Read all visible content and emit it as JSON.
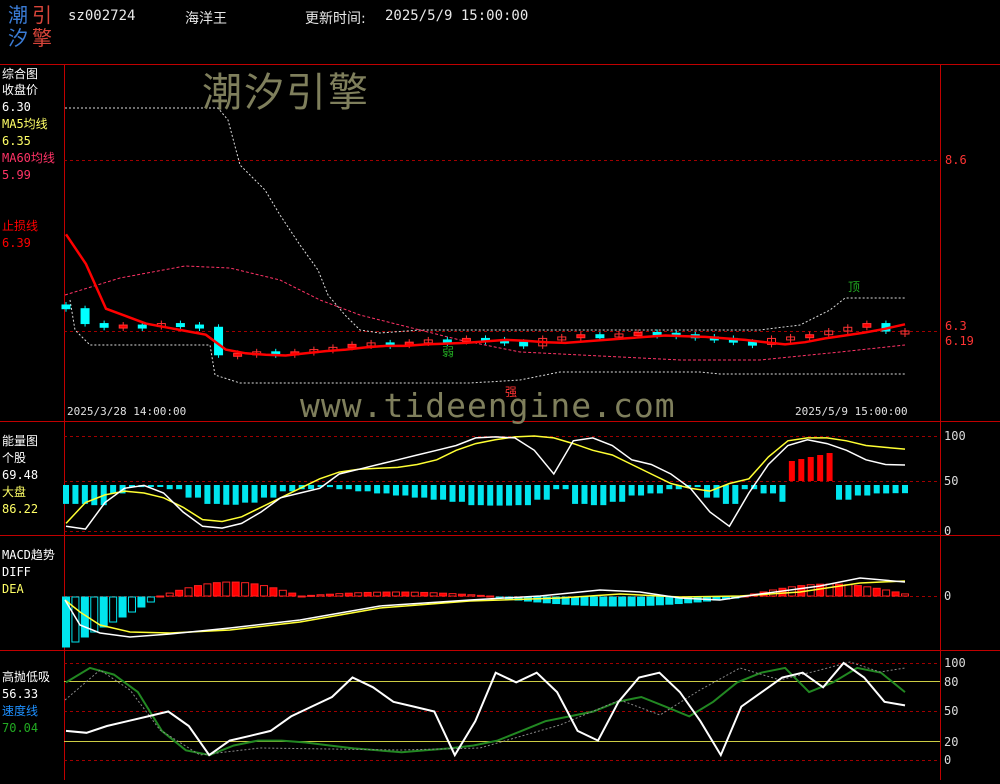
{
  "header": {
    "logo": [
      "潮",
      "引",
      "汐",
      "擎"
    ],
    "code": "sz002724",
    "name": "海洋王",
    "update_label": "更新时间:",
    "update_time": "2025/5/9 15:00:00"
  },
  "watermarks": {
    "brand": "潮汐引擎",
    "url": "www.tideengine.com"
  },
  "colors": {
    "up": "#ff0000",
    "down": "#00ffff",
    "ma5": "#ffff66",
    "ma60": "#ff3366",
    "stop": "#ff0000",
    "grid": "#c00000",
    "fast": "#ffffff",
    "speed": "#228822"
  },
  "panel_main": {
    "title": "综合图",
    "fields": [
      {
        "label": "收盘价",
        "value": "6.30",
        "color": "#ffffff"
      },
      {
        "label": "MA5均线",
        "value": "6.35",
        "color": "#ffff66"
      },
      {
        "label": "MA60均线",
        "value": "5.99",
        "color": "#ff3366"
      },
      {
        "label": "止损线",
        "value": "6.39",
        "color": "#ff0000"
      }
    ],
    "yticks": [
      {
        "text": "8.6",
        "color": "#ff3333"
      },
      {
        "text": "6.3",
        "color": "#ff3333"
      },
      {
        "text": "6.19",
        "color": "#ff3333"
      }
    ],
    "dates": [
      "2025/3/28 14:00:00",
      "2025/5/9 15:00:00"
    ],
    "markers": [
      {
        "text": "弱",
        "color": "#22aa22"
      },
      {
        "text": "强",
        "color": "#ff3333"
      },
      {
        "text": "顶",
        "color": "#22aa22"
      }
    ]
  },
  "panel_energy": {
    "title": "能量图",
    "fields": [
      {
        "label": "个股",
        "value": "69.48",
        "color": "#ffffff"
      },
      {
        "label": "大盘",
        "value": "86.22",
        "color": "#ffff66"
      }
    ],
    "yticks": [
      "100",
      "50",
      "0"
    ]
  },
  "panel_macd": {
    "title": "MACD趋势",
    "fields": [
      {
        "label": "DIFF",
        "color": "#ffffff"
      },
      {
        "label": "DEA",
        "color": "#ffff66"
      }
    ],
    "yticks": [
      "0"
    ]
  },
  "panel_osc": {
    "title": "高抛低吸",
    "fields": [
      {
        "label": "56.33",
        "color": "#ffffff"
      },
      {
        "label": "速度线",
        "color": "#1e90ff"
      },
      {
        "label": "70.04",
        "color": "#22aa22"
      }
    ],
    "yticks": [
      "100",
      "80",
      "50",
      "20",
      "0"
    ]
  },
  "chart_data": {
    "type": "line",
    "candles_close": [
      6.6,
      6.4,
      6.35,
      6.38,
      6.36,
      6.4,
      6.38,
      6.35,
      5.98,
      6.0,
      6.02,
      5.99,
      6.02,
      6.05,
      6.08,
      6.12,
      6.14,
      6.12,
      6.15,
      6.18,
      6.17,
      6.2,
      6.18,
      6.15,
      6.1,
      6.2,
      6.22,
      6.25,
      6.24,
      6.26,
      6.28,
      6.27,
      6.25,
      6.22,
      6.2,
      6.15,
      6.12,
      6.2,
      6.22,
      6.25,
      6.3,
      6.35,
      6.4,
      6.3,
      6.3
    ],
    "stop_line": [
      7.6,
      7.2,
      6.6,
      6.5,
      6.4,
      6.35,
      6.3,
      6.25,
      6.05,
      6.0,
      5.98,
      5.97,
      6.0,
      6.03,
      6.05,
      6.08,
      6.1,
      6.1,
      6.12,
      6.13,
      6.14,
      6.16,
      6.18,
      6.17,
      6.15,
      6.14,
      6.16,
      6.18,
      6.2,
      6.22,
      6.24,
      6.23,
      6.22,
      6.2,
      6.18,
      6.15,
      6.12,
      6.15,
      6.2,
      6.24,
      6.28,
      6.33,
      6.39
    ],
    "energy_stock": [
      5,
      2,
      30,
      45,
      48,
      40,
      20,
      5,
      3,
      8,
      20,
      35,
      40,
      45,
      60,
      65,
      70,
      75,
      80,
      85,
      90,
      98,
      99,
      98,
      85,
      60,
      95,
      98,
      90,
      75,
      70,
      60,
      45,
      20,
      5,
      40,
      70,
      90,
      96,
      92,
      85,
      75,
      70,
      69.48
    ],
    "energy_market": [
      8,
      30,
      38,
      42,
      40,
      35,
      25,
      12,
      10,
      15,
      25,
      35,
      45,
      55,
      62,
      65,
      66,
      67,
      70,
      75,
      85,
      92,
      96,
      99,
      100,
      98,
      92,
      85,
      80,
      70,
      60,
      50,
      45,
      42,
      50,
      55,
      78,
      95,
      98,
      98,
      95,
      90,
      88,
      86.22
    ],
    "osc_fast": [
      30,
      28,
      35,
      40,
      45,
      50,
      35,
      5,
      20,
      25,
      30,
      45,
      55,
      65,
      85,
      75,
      60,
      55,
      50,
      5,
      40,
      90,
      80,
      90,
      70,
      30,
      20,
      60,
      85,
      90,
      70,
      40,
      5,
      55,
      70,
      85,
      90,
      75,
      100,
      85,
      60,
      56.33
    ],
    "osc_speed": [
      80,
      95,
      88,
      70,
      30,
      10,
      5,
      15,
      20,
      20,
      18,
      15,
      12,
      10,
      8,
      10,
      12,
      15,
      20,
      30,
      40,
      45,
      50,
      60,
      65,
      55,
      45,
      60,
      80,
      90,
      95,
      70,
      80,
      95,
      90,
      70.04
    ]
  }
}
